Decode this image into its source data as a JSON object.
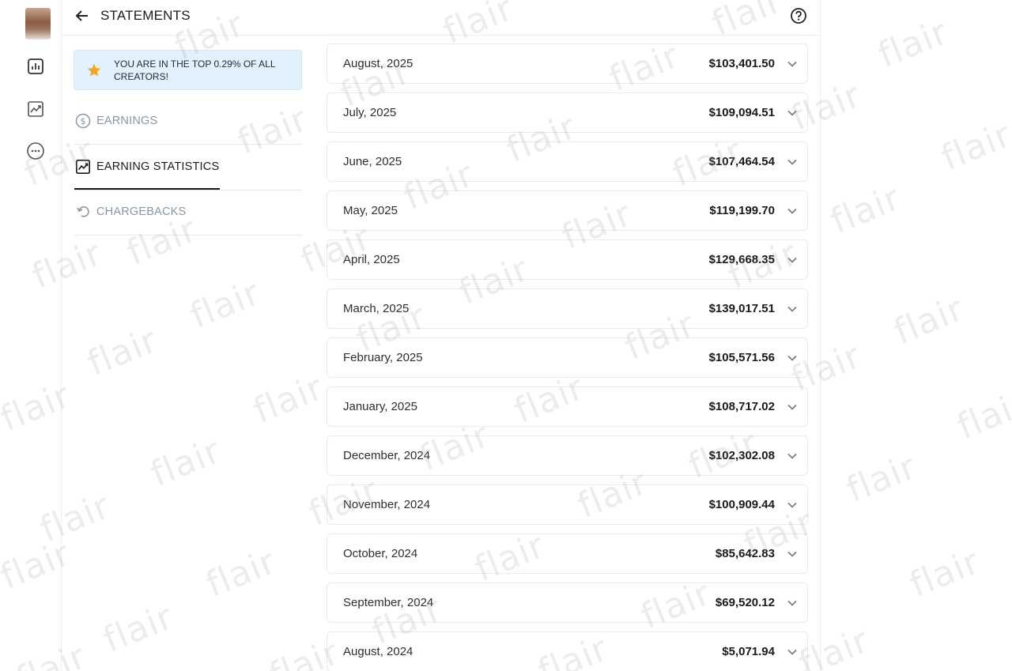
{
  "header": {
    "title": "STATEMENTS"
  },
  "rail": {
    "icons": [
      "statistics-icon",
      "trend-chart-icon",
      "more-icon"
    ]
  },
  "banner": {
    "text": "YOU ARE IN THE TOP 0.29% OF ALL CREATORS!"
  },
  "menu": {
    "earnings": "EARNINGS",
    "earning_statistics": "EARNING STATISTICS",
    "chargebacks": "CHARGEBACKS"
  },
  "statements": [
    {
      "month": "August, 2025",
      "amount": "$103,401.50"
    },
    {
      "month": "July, 2025",
      "amount": "$109,094.51"
    },
    {
      "month": "June, 2025",
      "amount": "$107,464.54"
    },
    {
      "month": "May, 2025",
      "amount": "$119,199.70"
    },
    {
      "month": "April, 2025",
      "amount": "$129,668.35"
    },
    {
      "month": "March, 2025",
      "amount": "$139,017.51"
    },
    {
      "month": "February, 2025",
      "amount": "$105,571.56"
    },
    {
      "month": "January, 2025",
      "amount": "$108,717.02"
    },
    {
      "month": "December, 2024",
      "amount": "$102,302.08"
    },
    {
      "month": "November, 2024",
      "amount": "$100,909.44"
    },
    {
      "month": "October, 2024",
      "amount": "$85,642.83"
    },
    {
      "month": "September, 2024",
      "amount": "$69,520.12"
    },
    {
      "month": "August, 2024",
      "amount": "$5,071.94"
    }
  ],
  "watermark": {
    "text": "flair"
  },
  "colors": {
    "banner_bg": "#e1f2fc",
    "star": "#f5a623",
    "inactive": "#8a96a3"
  }
}
